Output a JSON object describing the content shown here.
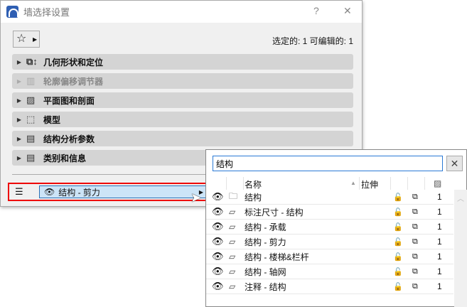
{
  "dialog": {
    "title": "墙选择设置",
    "help": "?",
    "close": "✕",
    "selection_info": "选定的: 1 可编辑的: 1",
    "sections": [
      {
        "label": "几何形状和定位",
        "icon": "geometry-icon",
        "disabled": false
      },
      {
        "label": "轮廓偏移调节器",
        "icon": "profile-icon",
        "disabled": true
      },
      {
        "label": "平面图和剖面",
        "icon": "floorplan-icon",
        "disabled": false
      },
      {
        "label": "模型",
        "icon": "model-icon",
        "disabled": false
      },
      {
        "label": "结构分析参数",
        "icon": "structural-analysis-icon",
        "disabled": false
      },
      {
        "label": "类别和信息",
        "icon": "info-icon",
        "disabled": false
      }
    ],
    "layer_value": "结构 - 剪力"
  },
  "popup": {
    "search_value": "结构",
    "clear": "✕",
    "columns": {
      "name": "名称",
      "extend": "拉伸"
    },
    "rows": [
      {
        "name": "结构",
        "type": "folder",
        "num": "1"
      },
      {
        "name": "标注尺寸 - 结构",
        "type": "layer",
        "num": "1"
      },
      {
        "name": "结构 - 承载",
        "type": "layer",
        "num": "1"
      },
      {
        "name": "结构 - 剪力",
        "type": "layer",
        "num": "1"
      },
      {
        "name": "结构 - 楼梯&栏杆",
        "type": "layer",
        "num": "1"
      },
      {
        "name": "结构 - 轴网",
        "type": "layer",
        "num": "1"
      },
      {
        "name": "注释 - 结构",
        "type": "layer",
        "num": "1"
      }
    ]
  }
}
